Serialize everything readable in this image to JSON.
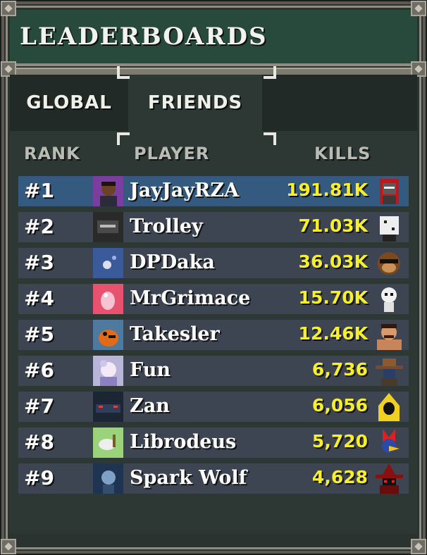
{
  "header": {
    "title": "LEADERBOARDS"
  },
  "tabs": [
    {
      "label": "GLOBAL",
      "active": false
    },
    {
      "label": "FRIENDS",
      "active": true
    }
  ],
  "columns": {
    "rank": "RANK",
    "player": "PLAYER",
    "kills": "KILLS"
  },
  "colors": {
    "header_bg": "#274a3d",
    "row_bg": "#3d4552",
    "row_highlight": "#355a80",
    "kills_text": "#f6ef2a"
  },
  "rows": [
    {
      "rank": "#1",
      "player": "JayJayRZA",
      "kills": "191.81K",
      "highlight": true,
      "avatar": "purple-portrait-avatar",
      "character": "red-hooded-robot-icon"
    },
    {
      "rank": "#2",
      "player": "Trolley",
      "kills": "71.03K",
      "avatar": "dark-logo-avatar",
      "character": "dice-head-icon"
    },
    {
      "rank": "#3",
      "player": "DPDaka",
      "kills": "36.03K",
      "avatar": "blue-sky-avatar",
      "character": "monkey-sunglasses-icon"
    },
    {
      "rank": "#4",
      "player": "MrGrimace",
      "kills": "15.70K",
      "avatar": "pink-creature-avatar",
      "character": "skeleton-icon"
    },
    {
      "rank": "#5",
      "player": "Takesler",
      "kills": "12.46K",
      "avatar": "orange-bird-avatar",
      "character": "muscle-man-icon"
    },
    {
      "rank": "#6",
      "player": "Fun",
      "kills": "6,736",
      "avatar": "anime-avatar",
      "character": "cowboy-hat-icon"
    },
    {
      "rank": "#7",
      "player": "Zan",
      "kills": "6,056",
      "avatar": "car-avatar",
      "character": "yellow-hood-icon"
    },
    {
      "rank": "#8",
      "player": "Librodeus",
      "kills": "5,720",
      "avatar": "green-animal-avatar",
      "character": "red-bird-icon"
    },
    {
      "rank": "#9",
      "player": "Spark Wolf",
      "kills": "4,628",
      "avatar": "wolf-avatar",
      "character": "red-wizard-icon"
    }
  ]
}
